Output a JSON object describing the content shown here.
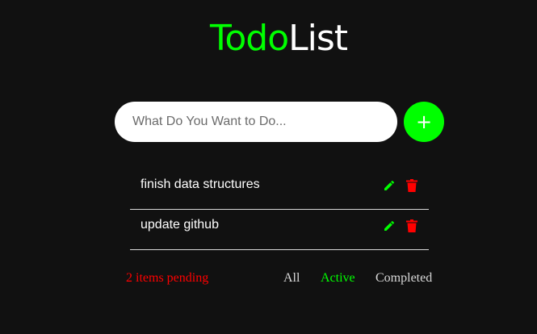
{
  "header": {
    "title_accent": "Todo",
    "title_rest": "List"
  },
  "input": {
    "placeholder": "What Do You Want to Do...",
    "value": "",
    "add_label": "+"
  },
  "todos": [
    {
      "text": "finish data structures"
    },
    {
      "text": "update github"
    }
  ],
  "footer": {
    "pending": "2 items pending",
    "filters": [
      "All",
      "Active",
      "Completed"
    ],
    "selected_filter": "Active"
  },
  "colors": {
    "accent": "#00ff00",
    "danger": "#ff0000",
    "background": "#111111"
  },
  "icons": {
    "edit": "pencil-icon",
    "delete": "trash-icon"
  }
}
